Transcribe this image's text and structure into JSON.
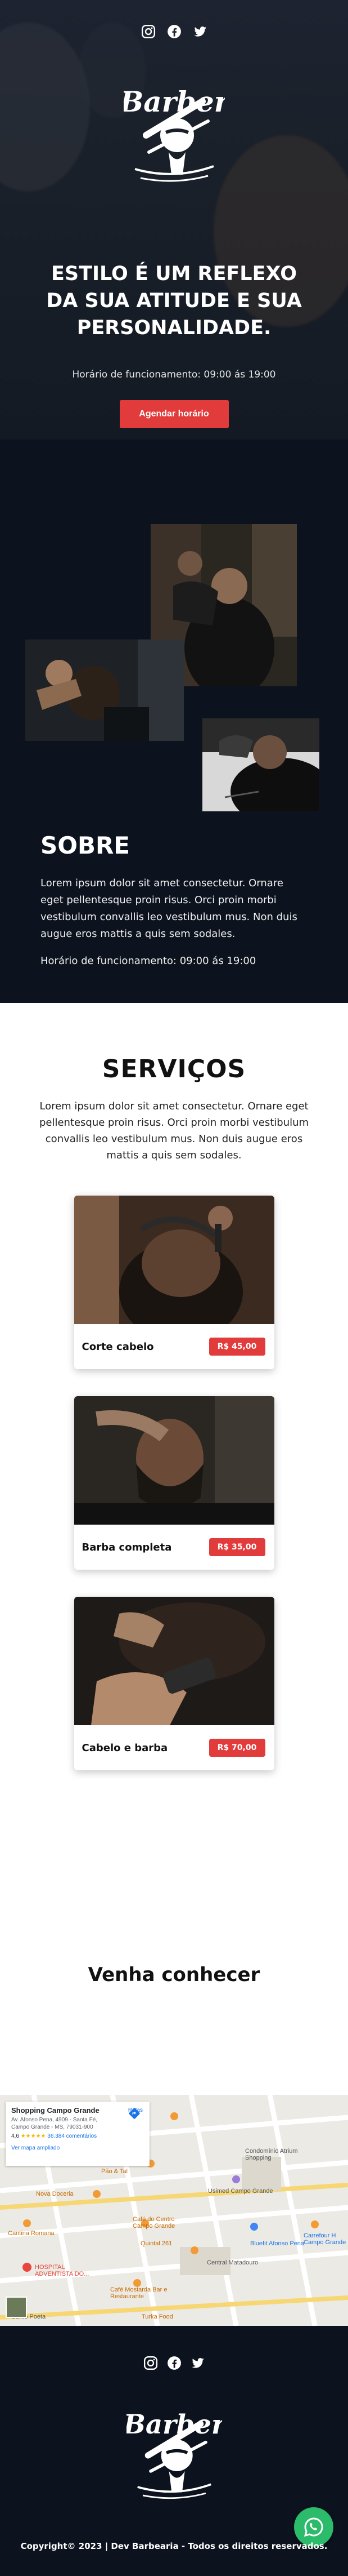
{
  "hero": {
    "headline": "ESTILO É UM REFLEXO DA SUA ATITUDE E SUA PERSONALIDADE.",
    "hours": "Horário de funcionamento: 09:00 ás 19:00",
    "cta_label": "Agendar horário"
  },
  "social": {
    "icons": [
      "instagram-icon",
      "facebook-icon",
      "twitter-icon"
    ]
  },
  "brand": {
    "logo_text": "Barber",
    "accent": "#e23b3b",
    "dark_bg": "#0d131e",
    "whatsapp": "#2bbb6a"
  },
  "sobre": {
    "title": "SOBRE",
    "text": "Lorem ipsum dolor sit amet consectetur. Ornare eget pellentesque proin risus. Orci proin morbi vestibulum convallis leo vestibulum mus. Non duis augue eros mattis a quis sem sodales.",
    "hours": "Horário de funcionamento: 09:00 ás 19:00"
  },
  "servicos": {
    "title": "SERVIÇOS",
    "intro": "Lorem ipsum dolor sit amet consectetur. Ornare eget pellentesque proin risus. Orci proin morbi vestibulum convallis leo vestibulum mus. Non duis augue eros mattis a quis sem sodales.",
    "items": [
      {
        "name": "Corte cabelo",
        "price": "R$ 45,00"
      },
      {
        "name": "Barba completa",
        "price": "R$ 35,00"
      },
      {
        "name": "Cabelo e barba",
        "price": "R$ 70,00"
      }
    ]
  },
  "venha": {
    "title": "Venha conhecer",
    "map": {
      "place": "Shopping Campo Grande",
      "address": "Av. Afonso Pena, 4909 - Santa Fé, Campo Grande - MS, 79031-900",
      "rating": "4,6",
      "stars": "★★★★★",
      "reviews": "36.384 comentários",
      "link": "Ver mapa ampliado",
      "route": "Rotas",
      "labels": [
        "Condomínio Atrium Shopping",
        "Usimed Campo Grande",
        "Café do Centro Campo Grande",
        "Quintal 261",
        "Bluefit Afonso Pena",
        "Central Matadouro",
        "Nova Doceria",
        "Pão & Tal",
        "Cantina Romana",
        "HOSPITAL ADVENTISTA DO...",
        "Café Mostarda Bar e Restaurante",
        "Turka Food",
        "Canto Poeta",
        "Carrefour H Campo Grande"
      ]
    }
  },
  "footer": {
    "copyright": "Copyright© 2023 | Dev Barbearia - Todos os direitos reservados."
  }
}
